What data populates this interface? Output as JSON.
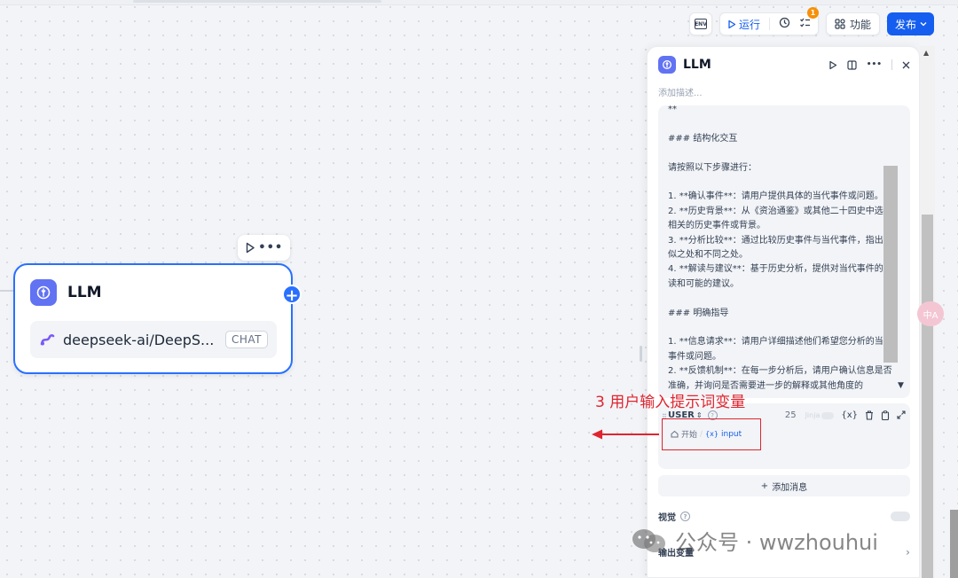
{
  "toolbar": {
    "env_icon": "env-icon",
    "env_text": "ENV",
    "run_label": "运行",
    "notification_count": "1",
    "features_label": "功能",
    "publish_label": "发布"
  },
  "node": {
    "title": "LLM",
    "model_name": "deepseek-ai/DeepS...",
    "mode_badge": "CHAT"
  },
  "panel": {
    "title": "LLM",
    "description_placeholder": "添加描述...",
    "system_prompt_lines": [
      "**",
      "",
      "### 结构化交互",
      "",
      "请按照以下步骤进行：",
      "",
      "1. **确认事件**：请用户提供具体的当代事件或问题。",
      "2. **历史背景**：从《资治通鉴》或其他二十四史中选择相关的历史事件或背景。",
      "3. **分析比较**：通过比较历史事件与当代事件，指出相似之处和不同之处。",
      "4. **解读与建议**：基于历史分析，提供对当代事件的解读和可能的建议。",
      "",
      "### 明确指导",
      "",
      "1. **信息请求**：请用户详细描述他们希望您分析的当代事件或问题。",
      "2. **反馈机制**：在每一步分析后，请用户确认信息是否准确，并询问是否需要进一步的解释或其他角度的"
    ],
    "user_message": {
      "role": "USER",
      "char_count": "25",
      "jinja_label": "Jinja",
      "variable_source": "开始",
      "variable_separator": "/",
      "variable_name": "input",
      "variable_icon_text": "{x}"
    },
    "add_message_label": "添加消息",
    "vision_label": "视觉",
    "output_variables_label": "输出变量"
  },
  "annotation": {
    "text": "3 用户输入提示词变量",
    "color": "#e0242f"
  },
  "watermark": {
    "text": "公众号 · wwzhouhui"
  },
  "side_badge": "中A",
  "colors": {
    "accent": "#155eef",
    "node_border": "#2970ff",
    "node_icon_bg": "#6172f3",
    "annotation": "#e0242f"
  }
}
